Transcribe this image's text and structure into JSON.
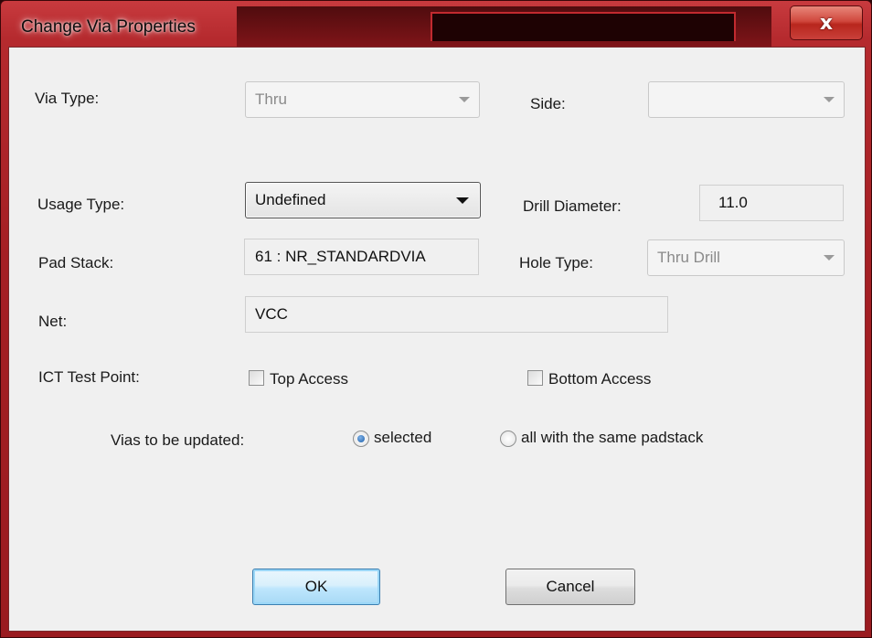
{
  "window": {
    "title": "Change Via Properties",
    "close_icon": "x-close-icon",
    "close_glyph": "x"
  },
  "via_type": {
    "label": "Via Type:",
    "value": "Thru"
  },
  "side": {
    "label": "Side:",
    "value": ""
  },
  "usage_type": {
    "label": "Usage Type:",
    "value": "Undefined"
  },
  "drill_diameter": {
    "label": "Drill Diameter:",
    "value": "11.0"
  },
  "pad_stack": {
    "label": "Pad Stack:",
    "value": "61 : NR_STANDARDVIA"
  },
  "hole_type": {
    "label": "Hole Type:",
    "value": "Thru Drill"
  },
  "net": {
    "label": "Net:",
    "value": "VCC"
  },
  "ict": {
    "label": "ICT Test Point:",
    "top_access": {
      "label": "Top Access",
      "checked": false
    },
    "bottom_access": {
      "label": "Bottom Access",
      "checked": false
    }
  },
  "vias_update": {
    "label": "Vias to be updated:",
    "selected_label": "selected",
    "same_padstack_label": "all with the same padstack",
    "value": "selected"
  },
  "buttons": {
    "ok": "OK",
    "cancel": "Cancel"
  },
  "colors": {
    "frame": "#a51f24",
    "client": "#f0f0f0",
    "default_button": "#bee6fd"
  }
}
